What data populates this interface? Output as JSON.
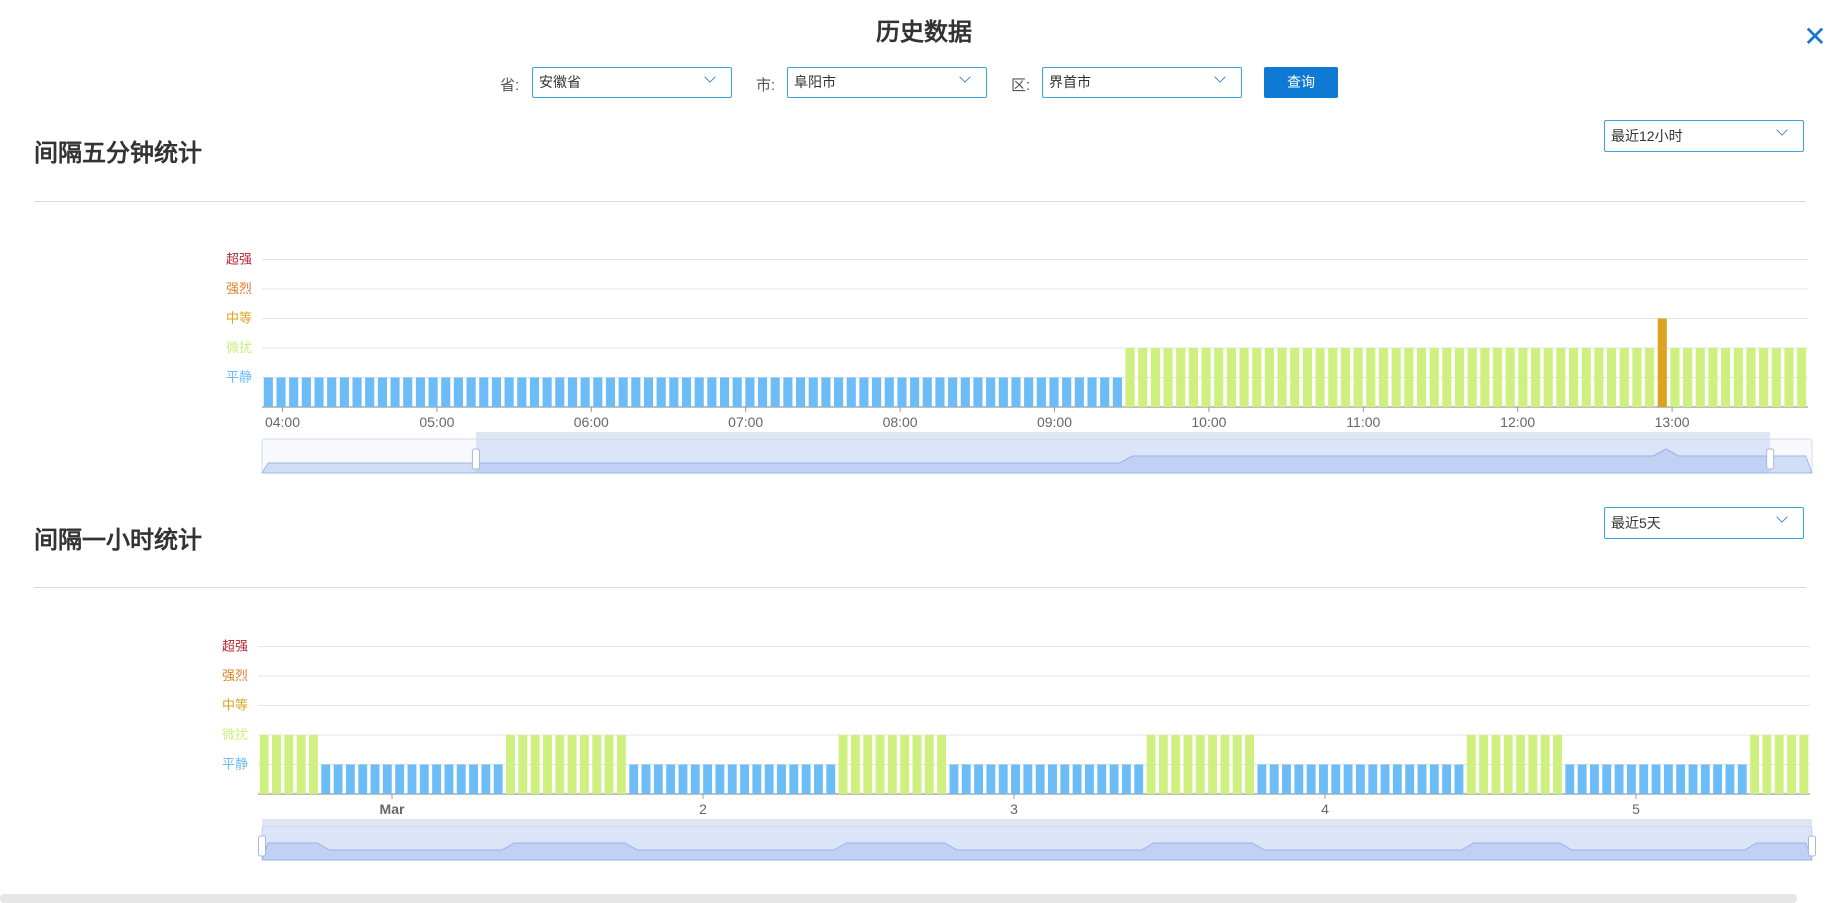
{
  "page": {
    "title": "历史数据",
    "close_icon": "close-icon"
  },
  "filters": {
    "province_label": "省:",
    "province_value": "安徽省",
    "city_label": "市:",
    "city_value": "阜阳市",
    "district_label": "区:",
    "district_value": "界首市",
    "query_label": "查询"
  },
  "section1": {
    "title": "间隔五分钟统计",
    "range_value": "最近12小时"
  },
  "section2": {
    "title": "间隔一小时统计",
    "range_value": "最近5天"
  },
  "colors": {
    "calm": "#6cbcf8",
    "slight": "#cdf07e",
    "medium": "#dba31f",
    "strong": "#e07f2c",
    "extreme": "#b5262e"
  },
  "chart_data": [
    {
      "type": "bar",
      "title": "间隔五分钟统计",
      "y_categories": [
        "平静",
        "微扰",
        "中等",
        "强烈",
        "超强"
      ],
      "x_ticks": [
        "04:00",
        "05:00",
        "06:00",
        "07:00",
        "08:00",
        "09:00",
        "10:00",
        "11:00",
        "12:00",
        "13:00"
      ],
      "time_start": "03:53",
      "interval_minutes": 5,
      "levels": [
        1,
        1,
        1,
        1,
        1,
        1,
        1,
        1,
        1,
        1,
        1,
        1,
        1,
        1,
        1,
        1,
        1,
        1,
        1,
        1,
        1,
        1,
        1,
        1,
        1,
        1,
        1,
        1,
        1,
        1,
        1,
        1,
        1,
        1,
        1,
        1,
        1,
        1,
        1,
        1,
        1,
        1,
        1,
        1,
        1,
        1,
        1,
        1,
        1,
        1,
        1,
        1,
        1,
        1,
        1,
        1,
        1,
        1,
        1,
        1,
        1,
        1,
        1,
        1,
        1,
        1,
        1,
        1,
        2,
        2,
        2,
        2,
        2,
        2,
        2,
        2,
        2,
        2,
        2,
        2,
        2,
        2,
        2,
        2,
        2,
        2,
        2,
        2,
        2,
        2,
        2,
        2,
        2,
        2,
        2,
        2,
        2,
        2,
        2,
        2,
        2,
        2,
        2,
        2,
        2,
        2,
        2,
        2,
        2,
        2,
        3,
        2,
        2,
        2,
        2,
        2,
        2,
        2,
        2,
        2,
        2,
        2
      ],
      "dataZoom": {
        "start_pct": 13.8,
        "end_pct": 97.3
      },
      "grid": true
    },
    {
      "type": "bar",
      "title": "间隔一小时统计",
      "y_categories": [
        "平静",
        "微扰",
        "中等",
        "强烈",
        "超强"
      ],
      "x_ticks": [
        "Mar",
        "2",
        "3",
        "4",
        "5"
      ],
      "interval_minutes": 60,
      "levels": [
        2,
        2,
        2,
        2,
        2,
        1,
        1,
        1,
        1,
        1,
        1,
        1,
        1,
        1,
        1,
        1,
        1,
        1,
        1,
        1,
        2,
        2,
        2,
        2,
        2,
        2,
        2,
        2,
        2,
        2,
        1,
        1,
        1,
        1,
        1,
        1,
        1,
        1,
        1,
        1,
        1,
        1,
        1,
        1,
        1,
        1,
        1,
        2,
        2,
        2,
        2,
        2,
        2,
        2,
        2,
        2,
        1,
        1,
        1,
        1,
        1,
        1,
        1,
        1,
        1,
        1,
        1,
        1,
        1,
        1,
        1,
        1,
        2,
        2,
        2,
        2,
        2,
        2,
        2,
        2,
        2,
        1,
        1,
        1,
        1,
        1,
        1,
        1,
        1,
        1,
        1,
        1,
        1,
        1,
        1,
        1,
        1,
        1,
        2,
        2,
        2,
        2,
        2,
        2,
        2,
        2,
        1,
        1,
        1,
        1,
        1,
        1,
        1,
        1,
        1,
        1,
        1,
        1,
        1,
        1,
        1,
        2,
        2,
        2,
        2,
        2
      ],
      "dataZoom": {
        "start_pct": 0,
        "end_pct": 100
      },
      "grid": true
    }
  ]
}
